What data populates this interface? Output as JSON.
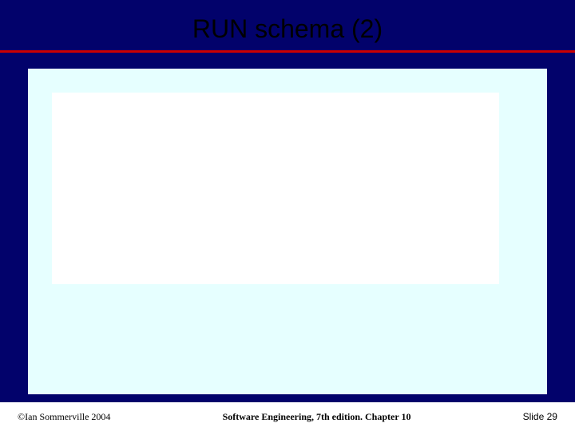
{
  "title": "RUN schema (2)",
  "footer": {
    "left": "©Ian Sommerville 2004",
    "center": "Software Engineering, 7th edition. Chapter 10",
    "right_prefix": "Slide ",
    "right_number": "29"
  }
}
